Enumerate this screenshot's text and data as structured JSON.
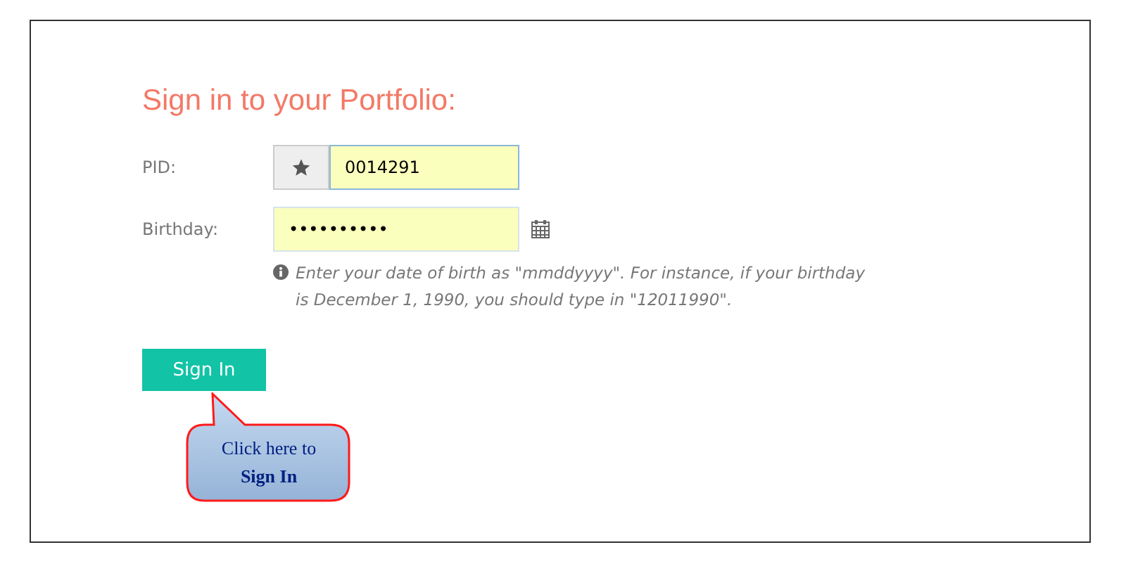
{
  "title": "Sign in to your Portfolio:",
  "fields": [
    {
      "label": "PID:",
      "value": "0014291",
      "kind": "prefixed"
    },
    {
      "label": "Birthday:",
      "value": "••••••••••",
      "kind": "date"
    }
  ],
  "hint": "Enter your date of birth as \"mmddyyyy\". For instance, if your birthday is December 1, 1990, you should type in \"12011990\".",
  "button": "Sign In",
  "callout": "Click here to\n**Sign In**"
}
